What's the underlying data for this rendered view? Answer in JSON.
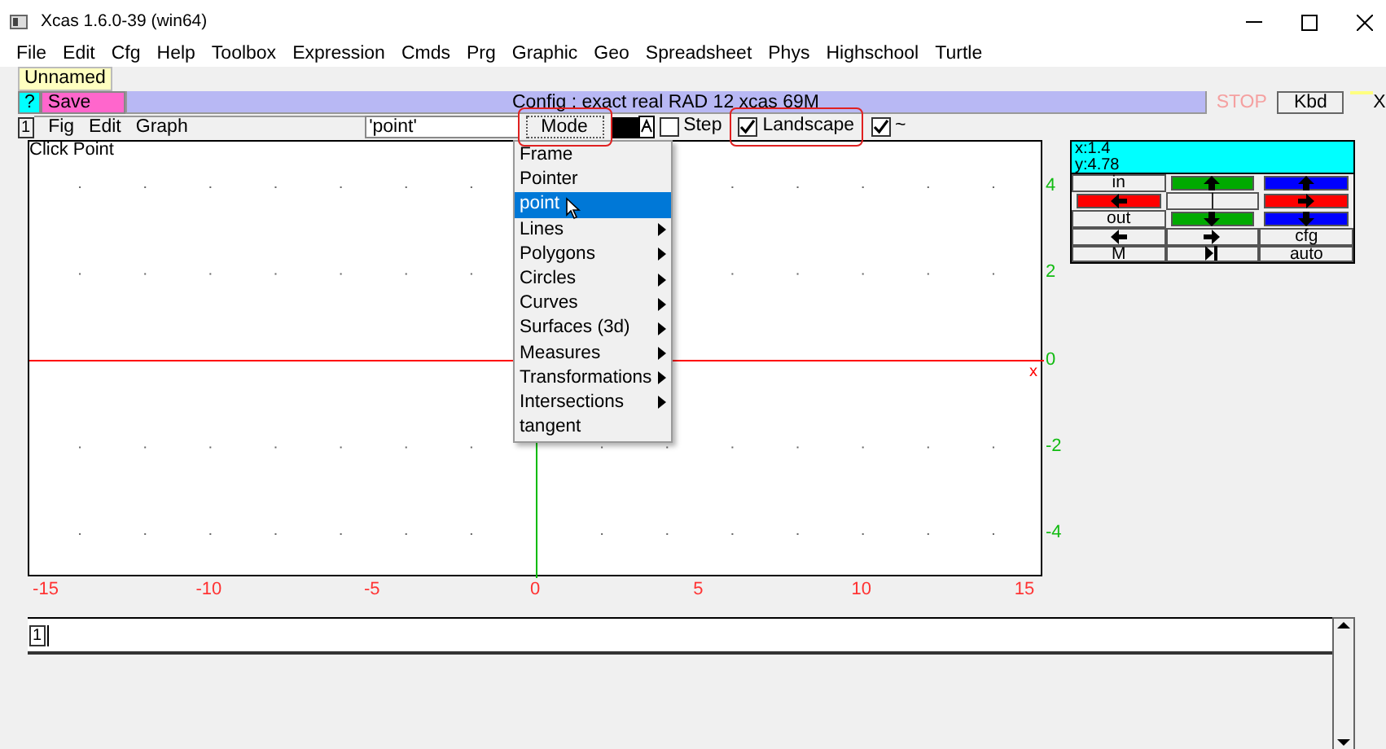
{
  "window": {
    "title": "Xcas 1.6.0-39 (win64)"
  },
  "menubar": [
    "File",
    "Edit",
    "Cfg",
    "Help",
    "Toolbox",
    "Expression",
    "Cmds",
    "Prg",
    "Graphic",
    "Geo",
    "Spreadsheet",
    "Phys",
    "Highschool",
    "Turtle"
  ],
  "tabs": [
    {
      "label": "Unnamed",
      "selected": true
    }
  ],
  "session_bar": {
    "help": "?",
    "save": "Save",
    "status": "Config : exact real RAD 12 xcas 69M",
    "stop": {
      "label": "STOP",
      "disabled": true
    },
    "kbd": "Kbd",
    "close": "X"
  },
  "level": {
    "number": "1",
    "menus": [
      "Fig",
      "Edit",
      "Graph"
    ],
    "mode_field": "'point'",
    "mode_button": {
      "label": "Mode",
      "highlighted": true
    },
    "color": "#000000",
    "checks": [
      {
        "label": "Step",
        "checked": false,
        "highlighted": false
      },
      {
        "label": "Landscape",
        "checked": true,
        "highlighted": true
      },
      {
        "label": "~",
        "checked": true,
        "highlighted": false
      }
    ]
  },
  "graph": {
    "hint": "Click Point",
    "x_labels": [
      "-15",
      "-10",
      "-5",
      "0",
      "5",
      "10",
      "15"
    ],
    "y_labels": [
      "4",
      "2",
      "0",
      "-2",
      "-4"
    ],
    "axis_label": "x"
  },
  "mode_menu": [
    {
      "label": "Frame",
      "submenu": false,
      "selected": false
    },
    {
      "label": "Pointer",
      "submenu": false,
      "selected": false
    },
    {
      "label": "point",
      "submenu": false,
      "selected": true
    },
    {
      "label": "Lines",
      "submenu": true,
      "selected": false
    },
    {
      "label": "Polygons",
      "submenu": true,
      "selected": false
    },
    {
      "label": "Circles",
      "submenu": true,
      "selected": false
    },
    {
      "label": "Curves",
      "submenu": true,
      "selected": false
    },
    {
      "label": "Surfaces (3d)",
      "submenu": true,
      "selected": false
    },
    {
      "label": "Measures",
      "submenu": true,
      "selected": false
    },
    {
      "label": "Transformations",
      "submenu": true,
      "selected": false
    },
    {
      "label": "Intersections",
      "submenu": true,
      "selected": false
    },
    {
      "label": "tangent",
      "submenu": false,
      "selected": false
    }
  ],
  "coords": [
    "x:1.4",
    "y:4.78"
  ],
  "controls": [
    [
      {
        "kind": "label",
        "text": "in"
      },
      {
        "kind": "up",
        "color": "#00aa00"
      },
      {
        "kind": "up",
        "color": "#0000ff"
      }
    ],
    [
      {
        "kind": "left",
        "color": "#ff0000"
      },
      {
        "kind": "label",
        "text": "|"
      },
      {
        "kind": "right",
        "color": "#ff0000"
      }
    ],
    [
      {
        "kind": "label",
        "text": "out"
      },
      {
        "kind": "down",
        "color": "#00aa00"
      },
      {
        "kind": "down",
        "color": "#0000ff"
      }
    ],
    [
      {
        "kind": "left"
      },
      {
        "kind": "right"
      },
      {
        "kind": "label",
        "text": "cfg"
      }
    ],
    [
      {
        "kind": "label",
        "text": "M"
      },
      {
        "kind": "step"
      },
      {
        "kind": "label",
        "text": "auto"
      }
    ]
  ],
  "command": {
    "number": "1"
  }
}
